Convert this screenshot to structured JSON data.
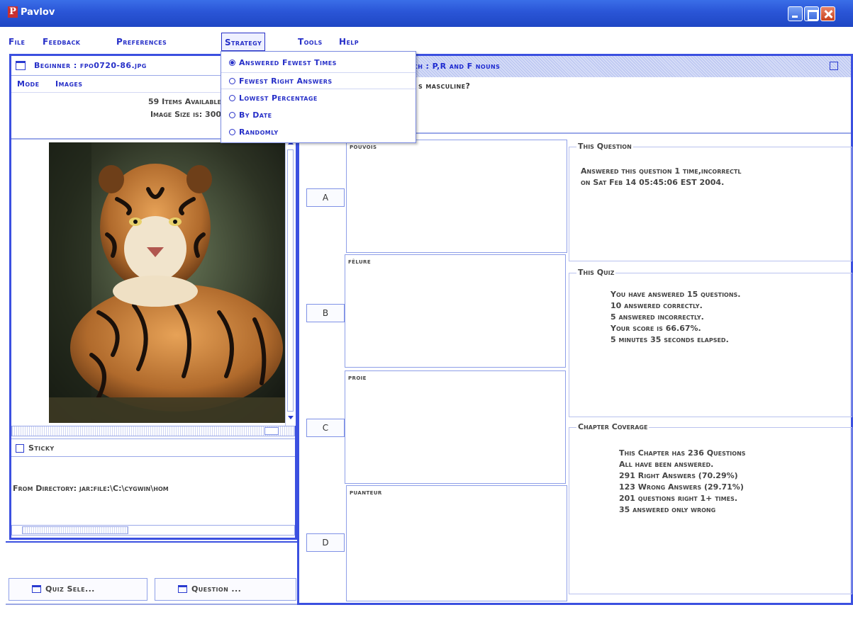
{
  "window": {
    "title": "Pavlov",
    "logo_letter": "P"
  },
  "menubar": [
    "File",
    "Feedback",
    "Preferences",
    "Strategy",
    "Tools",
    "Help"
  ],
  "strategy_menu": {
    "items": [
      {
        "label": "Answered Fewest Times",
        "selected": true
      },
      {
        "label": "Fewest Right Answers",
        "selected": false
      },
      {
        "label": "Lowest Percentage",
        "selected": false
      },
      {
        "label": "By Date",
        "selected": false
      },
      {
        "label": "Randomly",
        "selected": false
      }
    ]
  },
  "left_panel": {
    "title": "Beginner : fpo0720-86.jpg",
    "menus": [
      "Mode",
      "Images"
    ],
    "items_available": "59 Items Available",
    "image_size": "Image Size is: 300",
    "image_subject": "tiger",
    "sticky_label": "Sticky",
    "directory": "From Directory: jar:file:\\C:\\cygwin\\hom"
  },
  "right_panel": {
    "title_visible": "ench : P,R and F nouns",
    "question_visible": "s masculine?",
    "answers": [
      {
        "letter": "A",
        "word": "pouvois"
      },
      {
        "letter": "B",
        "word": "fêlure"
      },
      {
        "letter": "C",
        "word": "proie"
      },
      {
        "letter": "D",
        "word": "puanteur"
      }
    ],
    "this_question": {
      "title": "This Question",
      "lines": [
        "Answered this question 1 time,incorrectl",
        "on Sat Feb 14 05:45:06 EST 2004."
      ]
    },
    "this_quiz": {
      "title": "This Quiz",
      "lines": [
        "You have answered 15 questions.",
        "10 answered correctly.",
        "5 answered incorrectly.",
        "Your score is 66.67%.",
        "5 minutes 35 seconds elapsed."
      ]
    },
    "chapter_coverage": {
      "title": "Chapter Coverage",
      "lines": [
        "This Chapter has 236 Questions",
        "All have been answered.",
        "291 Right Answers (70.29%)",
        "123 Wrong Answers (29.71%)",
        "201 questions right 1+ times.",
        "35 answered only wrong"
      ]
    }
  },
  "taskbar": [
    "Quiz Sele...",
    "Question ..."
  ]
}
